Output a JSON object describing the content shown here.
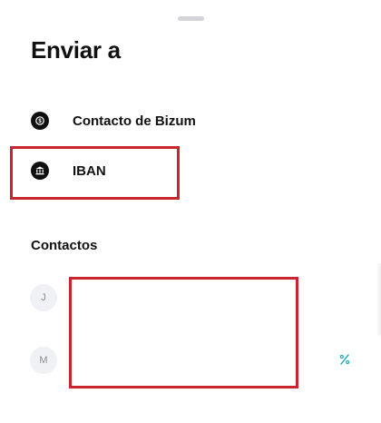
{
  "sheet": {
    "title": "Enviar a"
  },
  "options": [
    {
      "label": "Contacto de Bizum",
      "icon": "coin-icon"
    },
    {
      "label": "IBAN",
      "icon": "bank-icon"
    }
  ],
  "contacts": {
    "section_title": "Contactos",
    "groups": [
      {
        "initial": "J"
      },
      {
        "initial": "M"
      }
    ],
    "badge_icon": "percent-badge-icon"
  },
  "colors": {
    "highlight": "#c8262f",
    "accent_teal": "#1aa9b8",
    "icon_bg": "#0f0f0f"
  }
}
